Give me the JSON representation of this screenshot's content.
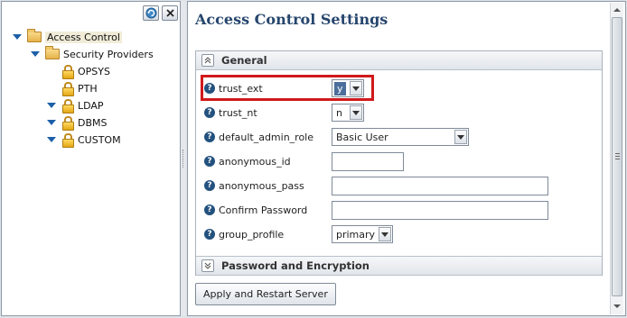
{
  "tree": {
    "toolbar": {
      "refresh_icon": "refresh-icon",
      "close_icon": "close-icon"
    },
    "items": [
      {
        "label": "Access Control",
        "icon": "folder-open-icon",
        "expanded": true,
        "selected": true
      },
      {
        "label": "Security Providers",
        "icon": "folder-open-icon",
        "expanded": true
      },
      {
        "label": "OPSYS",
        "icon": "lock-icon"
      },
      {
        "label": "PTH",
        "icon": "lock-icon"
      },
      {
        "label": "LDAP",
        "icon": "lock-icon",
        "expanded": true
      },
      {
        "label": "DBMS",
        "icon": "lock-icon",
        "expanded": true
      },
      {
        "label": "CUSTOM",
        "icon": "lock-icon",
        "expanded": true
      }
    ]
  },
  "main": {
    "title": "Access Control Settings",
    "sections": {
      "general": {
        "label": "General",
        "collapsed": false
      },
      "password": {
        "label": "Password and Encryption",
        "collapsed": true
      }
    },
    "fields": [
      {
        "label": "trust_ext",
        "type": "select",
        "value": "y",
        "focused": true
      },
      {
        "label": "trust_nt",
        "type": "select",
        "value": "n"
      },
      {
        "label": "default_admin_role",
        "type": "select",
        "value": "Basic User"
      },
      {
        "label": "anonymous_id",
        "type": "text",
        "value": ""
      },
      {
        "label": "anonymous_pass",
        "type": "text",
        "value": ""
      },
      {
        "label": "Confirm Password",
        "type": "text",
        "value": ""
      },
      {
        "label": "group_profile",
        "type": "select",
        "value": "primary"
      }
    ],
    "apply_button": "Apply and Restart Server",
    "colors": {
      "title": "#26466d",
      "focus_ring": "#d0191b",
      "help_icon": "#24527f"
    }
  }
}
